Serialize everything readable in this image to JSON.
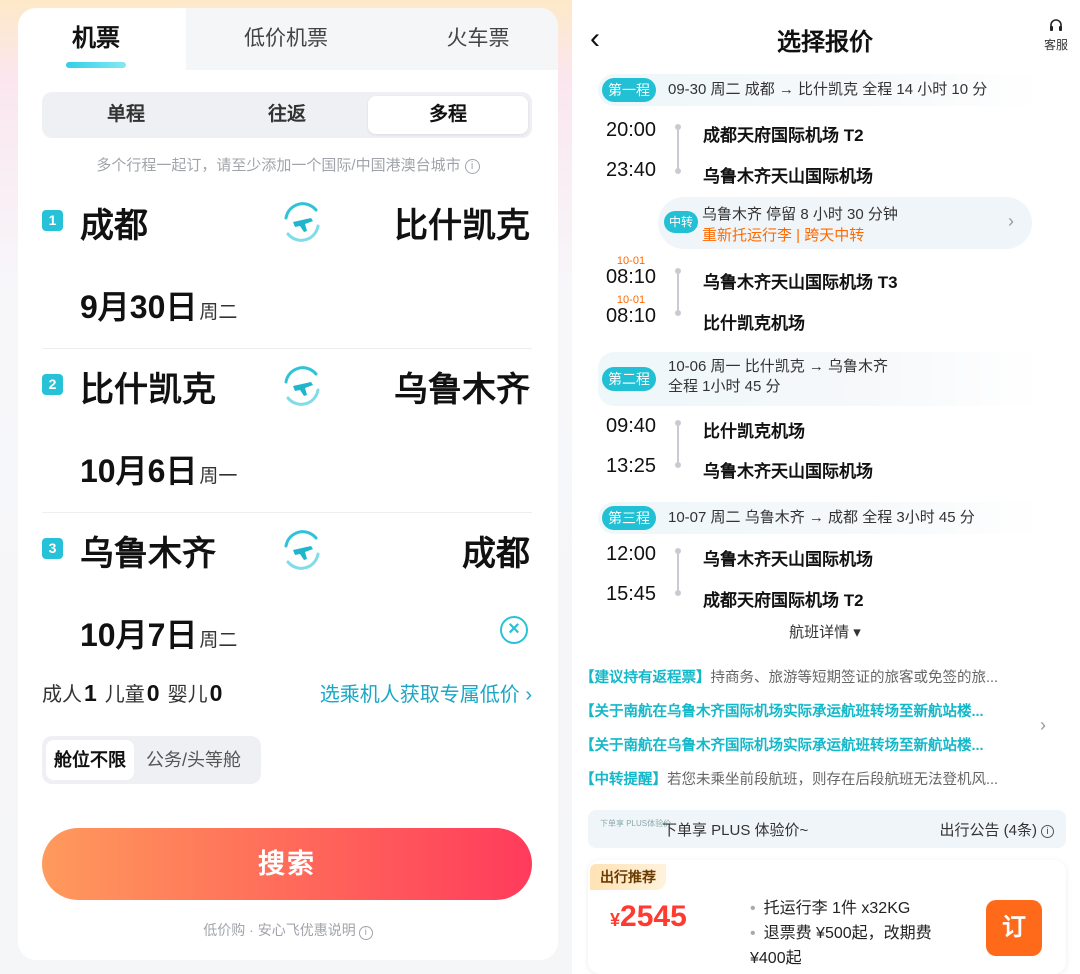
{
  "left": {
    "tabs": [
      "机票",
      "低价机票",
      "火车票"
    ],
    "trip_types": [
      "单程",
      "往返",
      "多程"
    ],
    "hint": "多个行程一起订，请至少添加一个国际/中国港澳台城市",
    "legs": [
      {
        "num": "1",
        "from": "成都",
        "to": "比什凯克",
        "date": "9月30日",
        "weekday": "周二"
      },
      {
        "num": "2",
        "from": "比什凯克",
        "to": "乌鲁木齐",
        "date": "10月6日",
        "weekday": "周一"
      },
      {
        "num": "3",
        "from": "乌鲁木齐",
        "to": "成都",
        "date": "10月7日",
        "weekday": "周二"
      }
    ],
    "pax": {
      "adult_label": "成人",
      "adult": "1",
      "child_label": "儿童",
      "child": "0",
      "infant_label": "婴儿",
      "infant": "0"
    },
    "pax_link": "选乘机人获取专属低价 ›",
    "cabin_options": [
      "舱位不限",
      "公务/头等舱"
    ],
    "search_label": "搜索",
    "footnote": "低价购 · 安心飞优惠说明"
  },
  "right": {
    "header": {
      "title": "选择报价",
      "service": "客服"
    },
    "segments": [
      {
        "badge": "第一程",
        "info": "09-30 周二   成都 → 比什凯克   全程 14 小时 10 分"
      },
      {
        "badge": "第二程",
        "info": "10-06 周一   比什凯克 → 乌鲁木齐",
        "info2": "全程 1小时 45 分"
      },
      {
        "badge": "第三程",
        "info": "10-07 周二   乌鲁木齐 → 成都   全程 3小时 45 分"
      }
    ],
    "flights": [
      {
        "time": "20:00",
        "airport": "成都天府国际机场 T2"
      },
      {
        "time": "23:40",
        "airport": "乌鲁木齐天山国际机场"
      },
      {
        "time": "08:10",
        "date": "10-01",
        "airport": "乌鲁木齐天山国际机场 T3"
      },
      {
        "time": "08:10",
        "date": "10-01",
        "airport": "比什凯克机场"
      },
      {
        "time": "09:40",
        "airport": "比什凯克机场"
      },
      {
        "time": "13:25",
        "airport": "乌鲁木齐天山国际机场"
      },
      {
        "time": "12:00",
        "airport": "乌鲁木齐天山国际机场"
      },
      {
        "time": "15:45",
        "airport": "成都天府国际机场 T2"
      }
    ],
    "transfer": {
      "badge": "中转",
      "line1": "乌鲁木齐  停留 8 小时 30 分钟",
      "line2": "重新托运行李 | 跨天中转"
    },
    "flight_detail": "航班详情 ▾",
    "notices": [
      {
        "tag": "【建议持有返程票】",
        "text": "持商务、旅游等短期签证的旅客或免签的旅..."
      },
      {
        "tag": "【关于南航在乌鲁木齐国际机场实际承运航班转场至新航站楼...",
        "text": ""
      },
      {
        "tag": "【关于南航在乌鲁木齐国际机场实际承运航班转场至新航站楼...",
        "text": ""
      },
      {
        "tag": "【中转提醒】",
        "text": "若您未乘坐前段航班，则存在后段航班无法登机风..."
      }
    ],
    "plus": {
      "logo": "下单享 PLUS体验价",
      "text": "下单享 PLUS 体验价~",
      "right": "出行公告 (4条)"
    },
    "offer": {
      "tag": "出行推荐",
      "currency": "¥",
      "price": "2545",
      "info1": "托运行李 1件 x32KG",
      "info2": "退票费 ¥500起，改期费",
      "info3": "¥400起",
      "button": "订"
    }
  },
  "colors": {
    "accent": "#22c0d5",
    "orange": "#ff6a00",
    "price": "#ff3a2f"
  }
}
